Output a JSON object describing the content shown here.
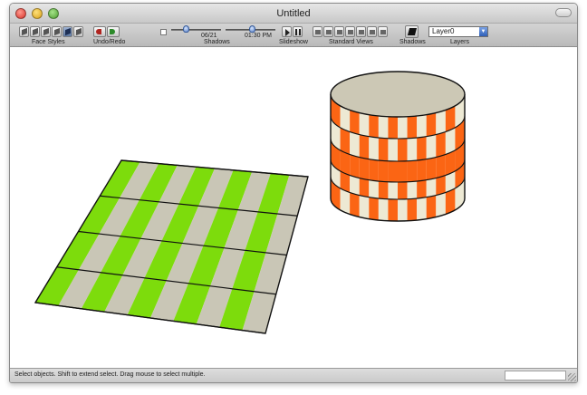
{
  "window": {
    "title": "Untitled"
  },
  "toolbar": {
    "face_styles_label": "Face Styles",
    "face_style_buttons": [
      "X-ray",
      "Wireframe",
      "Hidden Line",
      "Shaded",
      "Shaded with Textures",
      "Monochrome"
    ],
    "face_style_active_index": 4,
    "undo_redo_label": "Undo/Redo",
    "shadows_label": "Shadows",
    "shadow_date": "06/21",
    "shadow_time": "01:30 PM",
    "shadow_date_position": 0.3,
    "shadow_time_position": 0.55,
    "shadows_enabled": false,
    "slideshow_label": "Slideshow",
    "standard_views_label": "Standard Views",
    "standard_views_buttons": [
      "Iso",
      "Top",
      "Front",
      "Right",
      "Back",
      "Left"
    ],
    "shadows_button_label": "Shadows",
    "layers_label": "Layers",
    "current_layer": "Layer0"
  },
  "status": {
    "hint": "Select objects. Shift to extend select. Drag mouse to select multiple."
  },
  "colors": {
    "plane_green": "#7ddc0c",
    "plane_gray": "#c9c6b6",
    "cylinder_orange": "#fb6514",
    "cylinder_cream": "#ede9d4",
    "cylinder_top": "#ccc8b5",
    "edge": "#111111"
  }
}
